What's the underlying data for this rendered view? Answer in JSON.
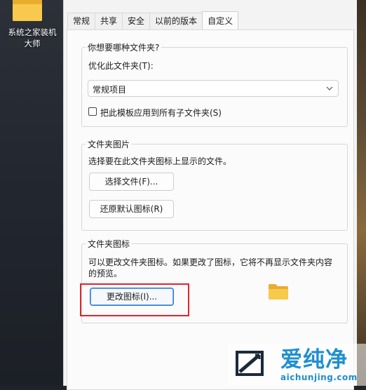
{
  "desktop": {
    "icon_label_line1": "系统之家装机",
    "icon_label_line2": "大师"
  },
  "tabs": [
    {
      "label": "常规"
    },
    {
      "label": "共享"
    },
    {
      "label": "安全"
    },
    {
      "label": "以前的版本"
    },
    {
      "label": "自定义",
      "active": true
    }
  ],
  "optimize_group": {
    "title": "你想要哪种文件夹?",
    "optimize_label": "优化此文件夹(T):",
    "select_value": "常规项目",
    "checkbox_label": "把此模板应用到所有子文件夹(S)",
    "checkbox_checked": false
  },
  "picture_group": {
    "title": "文件夹图片",
    "description": "选择要在此文件夹图标上显示的文件。",
    "choose_button": "选择文件(F)...",
    "restore_button": "还原默认图标(R)"
  },
  "icon_group": {
    "title": "文件夹图标",
    "description_line1": "可以更改文件夹图标。如果更改了图标，它将不再显示文件夹内容",
    "description_line2": "的预览。",
    "change_button": "更改图标(I)..."
  },
  "watermark": {
    "name": "爱纯净",
    "url": "aichunjing.com"
  },
  "colors": {
    "accent": "#2d7ad6",
    "highlight": "#e3242b",
    "folder": "#f8c94c",
    "watermark": "#1f8fd1"
  }
}
